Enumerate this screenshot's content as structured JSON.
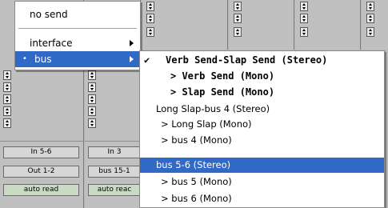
{
  "menu1": {
    "items": [
      {
        "label": "no send"
      },
      {
        "label": "interface",
        "has_submenu": true
      },
      {
        "label": "bus",
        "has_submenu": true,
        "selected_dot": "•"
      }
    ]
  },
  "submenu": {
    "check_glyph": "✔",
    "items": [
      {
        "label": "Verb Send-Slap Send (Stereo)",
        "bold": true,
        "checked": true
      },
      {
        "label": "> Verb Send (Mono)",
        "bold": true
      },
      {
        "label": "> Slap Send (Mono)",
        "bold": true
      },
      {
        "label": "Long Slap-bus 4 (Stereo)"
      },
      {
        "label": "> Long Slap (Mono)"
      },
      {
        "label": "> bus 4 (Mono)"
      },
      {
        "label": "bus 5-6 (Stereo)",
        "highlighted": true
      },
      {
        "label": "> bus 5 (Mono)"
      },
      {
        "label": "> bus 6 (Mono)"
      }
    ]
  },
  "strips": {
    "inputs": [
      "In 5-6",
      "In 3"
    ],
    "outputs": [
      "Out 1-2",
      "bus 15-1"
    ],
    "automation": [
      "auto read",
      "auto reac"
    ]
  },
  "colors": {
    "highlight": "#3169c6",
    "auto_button": "#c7dcc2"
  }
}
